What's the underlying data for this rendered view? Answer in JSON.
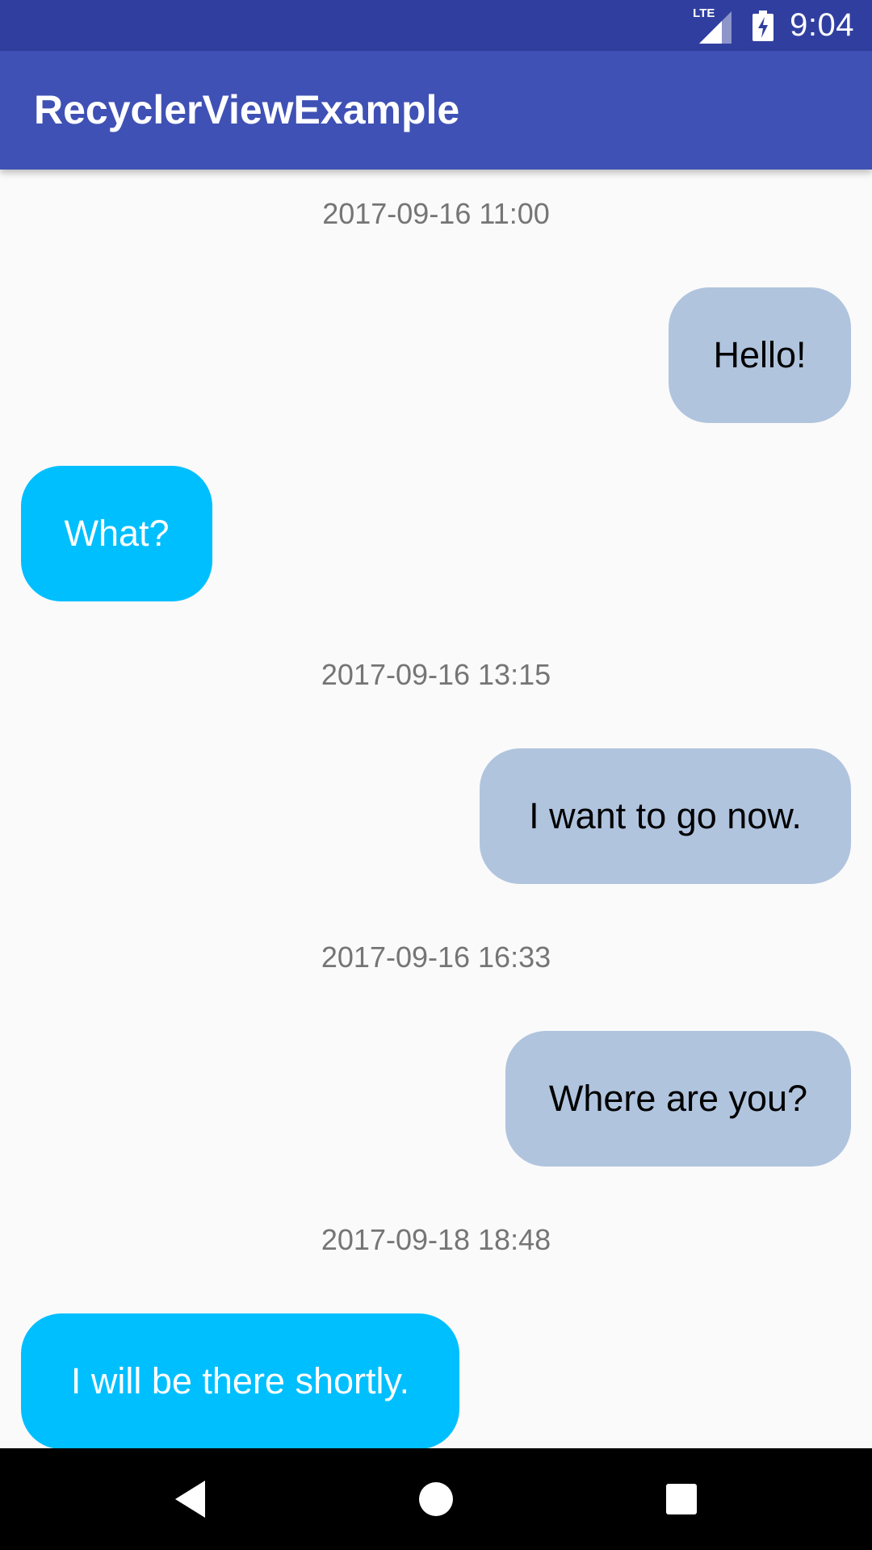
{
  "status_bar": {
    "time": "9:04",
    "network_label": "LTE",
    "icons": [
      "lte-signal-icon",
      "battery-charging-icon"
    ]
  },
  "app_bar": {
    "title": "RecyclerViewExample",
    "color": "#3f51b5"
  },
  "colors": {
    "status_bar": "#303f9f",
    "outgoing_bubble": "#b0c4de",
    "incoming_bubble": "#00bfff",
    "timestamp_text": "#757575",
    "background": "#fafafa"
  },
  "messages": [
    {
      "type": "timestamp",
      "text": "2017-09-16 11:00"
    },
    {
      "type": "outgoing",
      "text": "Hello!"
    },
    {
      "type": "incoming",
      "text": "What?"
    },
    {
      "type": "timestamp",
      "text": "2017-09-16 13:15"
    },
    {
      "type": "outgoing",
      "text": "I want to go now."
    },
    {
      "type": "timestamp",
      "text": "2017-09-16 16:33"
    },
    {
      "type": "outgoing",
      "text": "Where are you?"
    },
    {
      "type": "timestamp",
      "text": "2017-09-18 18:48"
    },
    {
      "type": "incoming",
      "text": "I will be there shortly."
    }
  ],
  "nav_bar": {
    "buttons": [
      "back-icon",
      "home-icon",
      "recents-icon"
    ]
  }
}
